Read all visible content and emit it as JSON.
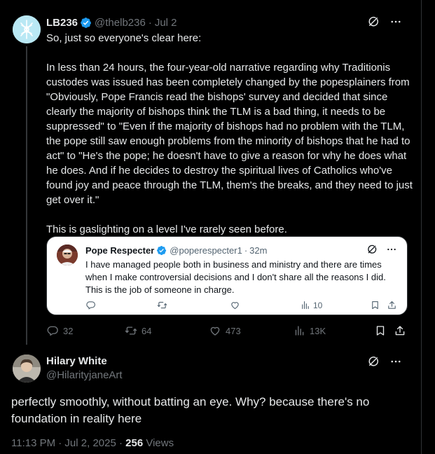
{
  "tweet": {
    "author_name": "LB236",
    "author_handle": "@thelb236",
    "separator": "·",
    "date": "Jul 2",
    "paragraphs": [
      "So, just so everyone's clear here:",
      "In less than 24 hours, the four-year-old narrative regarding why Traditionis custodes was issued has been completely changed by the popesplainers from \"Obviously, Pope Francis read the bishops' survey and decided that since clearly the majority of bishops think the TLM is a bad thing, it needs to be suppressed\" to \"Even if the majority of bishops had no problem with the TLM, the pope still saw enough problems from the minority of bishops that he had to act\" to \"He's the pope; he doesn't have to give a reason for why he does what he does. And if he decides to destroy the spiritual lives of Catholics who've found joy and peace through the TLM, them's the breaks, and they need to just get over it.\"",
      "This is gaslighting on a level I've rarely seen before."
    ],
    "stats": {
      "replies": "32",
      "retweets": "64",
      "likes": "473",
      "views": "13K"
    }
  },
  "quote": {
    "author_name": "Pope Respecter",
    "author_handle": "@poperespecter1",
    "separator": "·",
    "time": "32m",
    "text": "I have managed people both in business and ministry and there are times when I make controversial decisions and I don't share all the reasons I did. This is the job of someone in charge.",
    "stats": {
      "views": "10"
    }
  },
  "reply": {
    "author_name": "Hilary White",
    "author_handle": "@HilarityjaneArt",
    "text": "perfectly smoothly, without batting an eye. Why? because there's no foundation in reality here",
    "timestamp": "11:13 PM · Jul 2, 2025 ·",
    "views_count": "256",
    "views_label": "Views"
  },
  "colors": {
    "background": "#000000",
    "text_primary": "#e7e9ea",
    "text_secondary": "#71767b",
    "verified": "#1d9bf0",
    "border": "#2f3336"
  },
  "icons": [
    "verified-badge-icon",
    "grok-icon",
    "more-icon",
    "reply-icon",
    "retweet-icon",
    "like-icon",
    "views-icon",
    "bookmark-icon",
    "share-icon"
  ]
}
